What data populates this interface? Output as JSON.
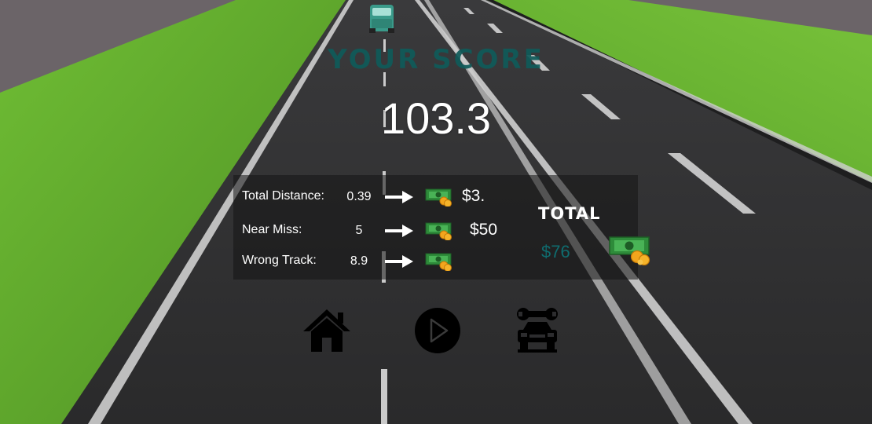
{
  "score": {
    "title": "YOUR SCORE",
    "value": "103.3"
  },
  "stats": [
    {
      "label": "Total Distance:",
      "value": "0.39",
      "reward": "$3."
    },
    {
      "label": "Near Miss:",
      "value": "5",
      "reward": "$50"
    },
    {
      "label": "Wrong Track:",
      "value": "8.9",
      "reward": ""
    }
  ],
  "total": {
    "label": "TOTAL",
    "value": "$76"
  },
  "buttons": {
    "home": "home-icon",
    "play": "play-icon",
    "garage": "car-repair-icon"
  },
  "colors": {
    "score_title": "#0f5b5a",
    "total_value": "#0f6c6f",
    "grass": "#5fa82c",
    "road": "#2c2c2e"
  }
}
